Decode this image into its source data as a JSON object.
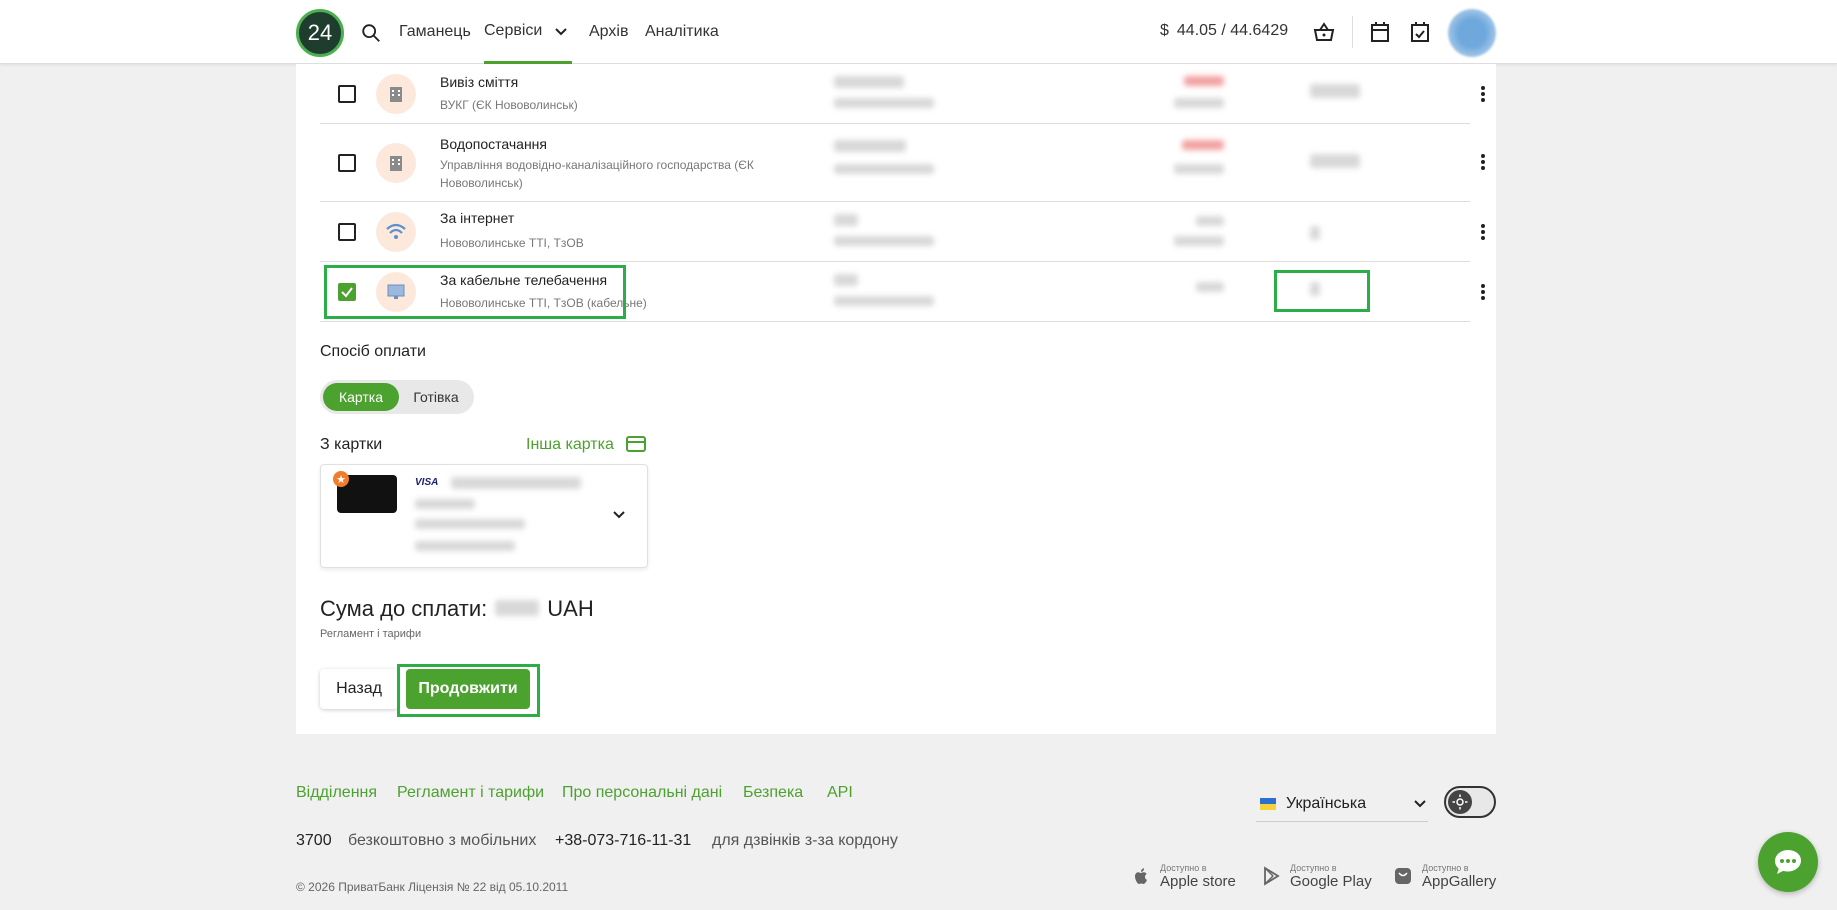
{
  "header": {
    "logo": "24",
    "nav": [
      "Гаманець",
      "Сервіси",
      "Архів",
      "Аналітика"
    ],
    "currency_symbol": "$",
    "rate": "44.05 / 44.6429"
  },
  "bills": [
    {
      "title": "Вивіз сміття",
      "subtitle": "ВУКГ (ЄК Нововолинськ)",
      "checked": false,
      "icon": "building-icon"
    },
    {
      "title": "Водопостачання",
      "subtitle": "Управління водовідно-каналізаційного господарства (ЄК Нововолинськ)",
      "checked": false,
      "icon": "building-icon"
    },
    {
      "title": "За інтернет",
      "subtitle": "Нововолинське ТТІ, ТзОВ",
      "checked": false,
      "icon": "wifi-icon"
    },
    {
      "title": "За кабельне телебачення",
      "subtitle": "Нововолинське ТТІ, ТзОВ (кабельне)",
      "checked": true,
      "icon": "monitor-icon"
    }
  ],
  "payment": {
    "method_label": "Спосіб оплати",
    "options": [
      "Картка",
      "Готівка"
    ],
    "from_card_label": "З картки",
    "other_card_link": "Інша картка",
    "card_brand": "VISA",
    "total_label": "Сума до сплати:",
    "currency": "UAH",
    "tariffs_link": "Регламент і тарифи"
  },
  "actions": {
    "back": "Назад",
    "next": "Продовжити"
  },
  "footer": {
    "links": [
      "Відділення",
      "Регламент і тарифи",
      "Про персональні дані",
      "Безпека",
      "API"
    ],
    "phone_short": "3700",
    "phone_short_note": "безкоштовно з мобільних",
    "phone_intl": "+38-073-716-11-31",
    "phone_intl_note": "для дзвінків з-за кордону",
    "copyright": "© 2026 ПриватБанк Ліцензія № 22 від 05.10.2011",
    "language": "Українська",
    "stores": [
      {
        "small": "Доступно в",
        "name": "Apple store"
      },
      {
        "small": "Доступно в",
        "name": "Google Play"
      },
      {
        "small": "Доступно в",
        "name": "AppGallery"
      }
    ]
  },
  "colors": {
    "accent": "#4ca22f",
    "highlight": "#2bad48"
  }
}
